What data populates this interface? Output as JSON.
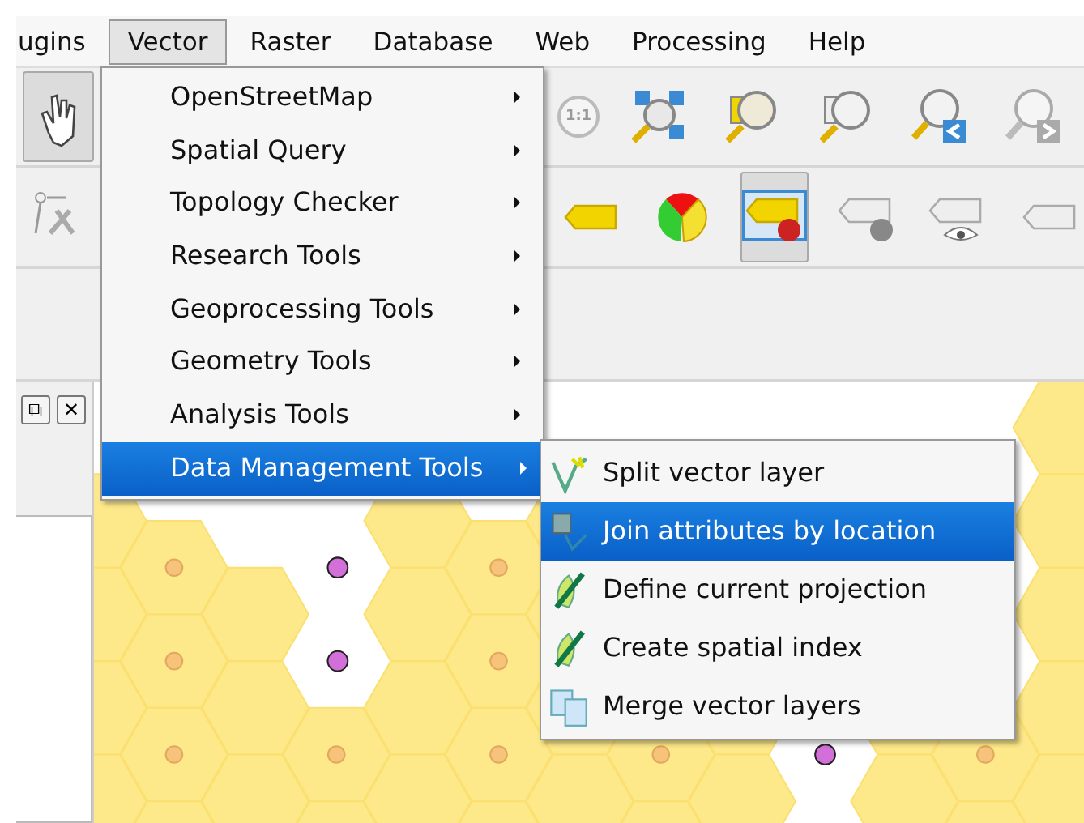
{
  "menubar": [
    {
      "label": "ugins",
      "selected": false
    },
    {
      "label": "Vector",
      "selected": true
    },
    {
      "label": "Raster",
      "selected": false
    },
    {
      "label": "Database",
      "selected": false
    },
    {
      "label": "Web",
      "selected": false
    },
    {
      "label": "Processing",
      "selected": false
    },
    {
      "label": "Help",
      "selected": false
    }
  ],
  "vector_menu": [
    {
      "label": "OpenStreetMap",
      "selected": false,
      "has_submenu": true
    },
    {
      "label": "Spatial Query",
      "selected": false,
      "has_submenu": true
    },
    {
      "label": "Topology Checker",
      "selected": false,
      "has_submenu": true
    },
    {
      "label": "Research Tools",
      "selected": false,
      "has_submenu": true
    },
    {
      "label": "Geoprocessing Tools",
      "selected": false,
      "has_submenu": true
    },
    {
      "label": "Geometry Tools",
      "selected": false,
      "has_submenu": true
    },
    {
      "label": "Analysis Tools",
      "selected": false,
      "has_submenu": true
    },
    {
      "label": "Data Management Tools",
      "selected": true,
      "has_submenu": true
    }
  ],
  "submenu": [
    {
      "label": "Split vector layer",
      "selected": false,
      "kind": "split"
    },
    {
      "label": "Join attributes by location",
      "selected": true,
      "kind": "join"
    },
    {
      "label": "Define current projection",
      "selected": false,
      "kind": "tool"
    },
    {
      "label": "Create spatial index",
      "selected": false,
      "kind": "tool"
    },
    {
      "label": "Merge vector layers",
      "selected": false,
      "kind": "merge"
    }
  ],
  "panel_buttons": [
    "⧉",
    "✕"
  ],
  "map_text": "1:1"
}
